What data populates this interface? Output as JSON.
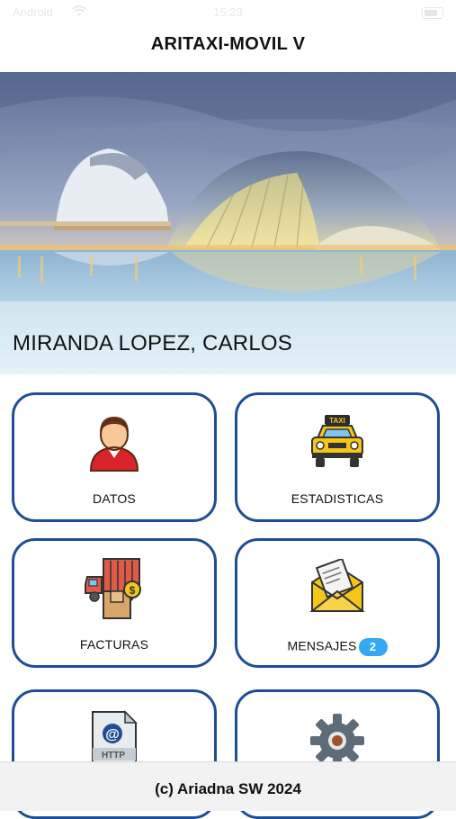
{
  "status_bar": {
    "carrier": "Android",
    "time": "15:23"
  },
  "header": {
    "title": "ARITAXI-MOVIL V"
  },
  "user": {
    "name": "MIRANDA LOPEZ, CARLOS"
  },
  "menu": [
    {
      "label": "DATOS",
      "icon": "user-avatar-icon"
    },
    {
      "label": "ESTADISTICAS",
      "icon": "taxi-icon"
    },
    {
      "label": "FACTURAS",
      "icon": "invoice-truck-icon"
    },
    {
      "label": "MENSAJES",
      "icon": "envelope-letter-icon",
      "badge": "2"
    },
    {
      "label": "",
      "icon": "http-web-icon"
    },
    {
      "label": "",
      "icon": "gear-icon"
    }
  ],
  "footer": {
    "copyright": "(c) Ariadna SW 2024"
  },
  "colors": {
    "card_border": "#1f4e96",
    "badge": "#34a8f0",
    "footer_bg": "#f2f2f2"
  }
}
